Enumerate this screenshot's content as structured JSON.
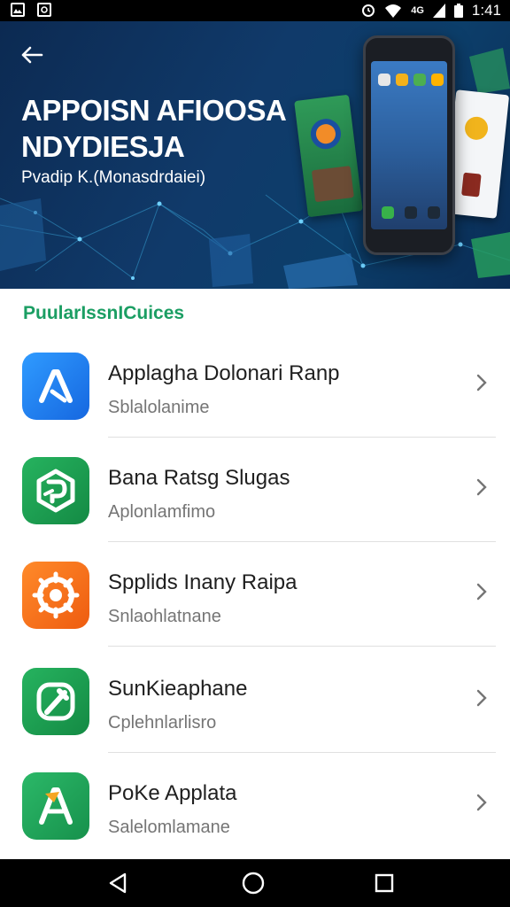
{
  "status_bar": {
    "time": "1:41",
    "left_icons": [
      "image-icon",
      "app-notification-icon"
    ],
    "right_icons": [
      "alarm-icon",
      "wifi-icon",
      "signal-icon",
      "battery-icon"
    ],
    "signal_label": "4G"
  },
  "header": {
    "title_line1": "APPOISN AFIOOSA",
    "title_line2": "NDYDIESJA",
    "subtitle": "Pvadip K.(Monasdrdaiei)",
    "back_icon": "arrow-left-icon",
    "background_color": "#0f3764"
  },
  "section": {
    "title": "PuularIssnICuices",
    "accent_color": "#1b9e63"
  },
  "apps": [
    {
      "name": "Applagha Dolonari Ranp",
      "subtitle": "Sblalolanime",
      "icon": "app-store-a-icon",
      "color": "#1a7cf0"
    },
    {
      "name": "Bana Ratsg Slugas",
      "subtitle": "Aplonlamfimo",
      "icon": "hexagon-puzzle-icon",
      "color": "#1f9d4d"
    },
    {
      "name": "Spplids Inany Raipa",
      "subtitle": "Snlaohlatnane",
      "icon": "gear-target-icon",
      "color": "#f26b1d"
    },
    {
      "name": "SunKieaphane",
      "subtitle": "Cplehnlarlisro",
      "icon": "pencil-tool-icon",
      "color": "#1f9d4d"
    },
    {
      "name": "PoKe Applata",
      "subtitle": "Salelomlamane",
      "icon": "letter-a-icon",
      "color": "#22a35b"
    }
  ],
  "nav_bar": {
    "back_icon": "triangle-back-icon",
    "home_icon": "circle-home-icon",
    "recents_icon": "square-recents-icon"
  }
}
